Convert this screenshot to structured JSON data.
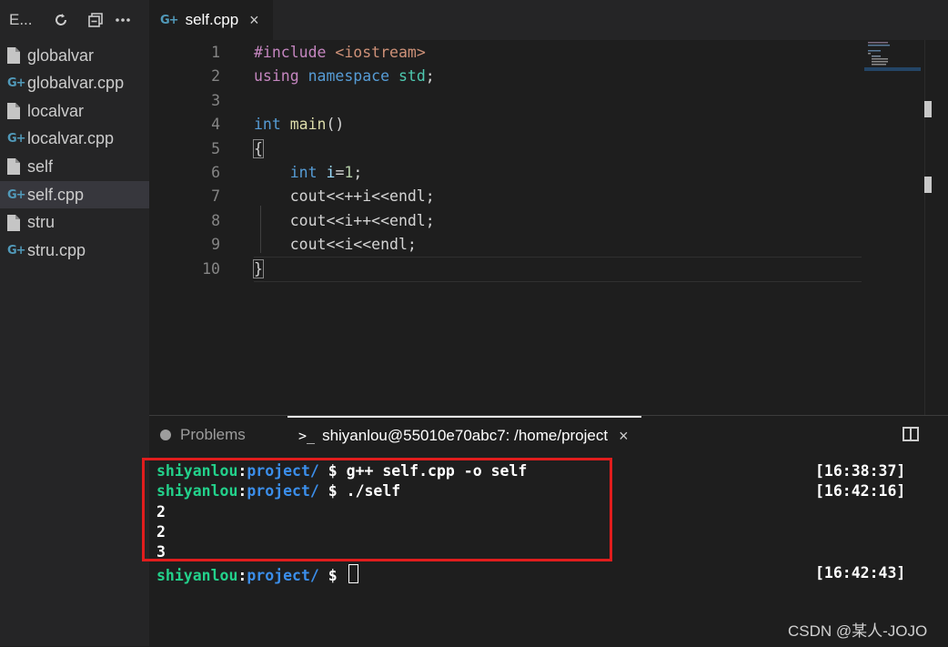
{
  "sidebar": {
    "title": "E...",
    "actions": [
      {
        "name": "refresh-icon"
      },
      {
        "name": "collapse-all-icon"
      },
      {
        "name": "more-icon"
      }
    ],
    "files": [
      {
        "label": "globalvar",
        "icon": "file-icon",
        "active": false
      },
      {
        "label": "globalvar.cpp",
        "icon": "cpp-file-icon",
        "active": false
      },
      {
        "label": "localvar",
        "icon": "file-icon",
        "active": false
      },
      {
        "label": "localvar.cpp",
        "icon": "cpp-file-icon",
        "active": false
      },
      {
        "label": "self",
        "icon": "file-icon",
        "active": false
      },
      {
        "label": "self.cpp",
        "icon": "cpp-file-icon",
        "active": true
      },
      {
        "label": "stru",
        "icon": "file-icon",
        "active": false
      },
      {
        "label": "stru.cpp",
        "icon": "cpp-file-icon",
        "active": false
      }
    ]
  },
  "editor": {
    "tab": {
      "label": "self.cpp",
      "close": "×"
    },
    "cpp_glyph": "G+",
    "lines": [
      {
        "n": "1",
        "text": "#include <iostream>"
      },
      {
        "n": "2",
        "text": "using namespace std;"
      },
      {
        "n": "3",
        "text": ""
      },
      {
        "n": "4",
        "text": "int main()"
      },
      {
        "n": "5",
        "text": "{"
      },
      {
        "n": "6",
        "text": "    int i=1;"
      },
      {
        "n": "7",
        "text": "    cout<<++i<<endl;"
      },
      {
        "n": "8",
        "text": "    cout<<i++<<endl;"
      },
      {
        "n": "9",
        "text": "    cout<<i<<endl;"
      },
      {
        "n": "10",
        "text": "}"
      }
    ]
  },
  "panel": {
    "problems_label": "Problems",
    "terminal_prompt_icon": ">_",
    "terminal_label": "shiyanlou@55010e70abc7: /home/project",
    "terminal_close": "×"
  },
  "terminal": {
    "user": "shiyanlou",
    "path": "project/",
    "lines": [
      {
        "kind": "prompt",
        "cmd": "$ g++ self.cpp -o self",
        "time": "[16:38:37]"
      },
      {
        "kind": "prompt",
        "cmd": "$ ./self",
        "time": "[16:42:16]"
      },
      {
        "kind": "output",
        "text": "2"
      },
      {
        "kind": "output",
        "text": "2"
      },
      {
        "kind": "output",
        "text": "3"
      },
      {
        "kind": "prompt",
        "cmd": "$ ",
        "time": "[16:42:43]",
        "cursor": true
      }
    ]
  },
  "watermark": "CSDN @某人-JOJO",
  "colors": {
    "highlight_box": "#e11d1d",
    "terminal_user": "#23d18b",
    "terminal_path": "#3b8eea"
  }
}
